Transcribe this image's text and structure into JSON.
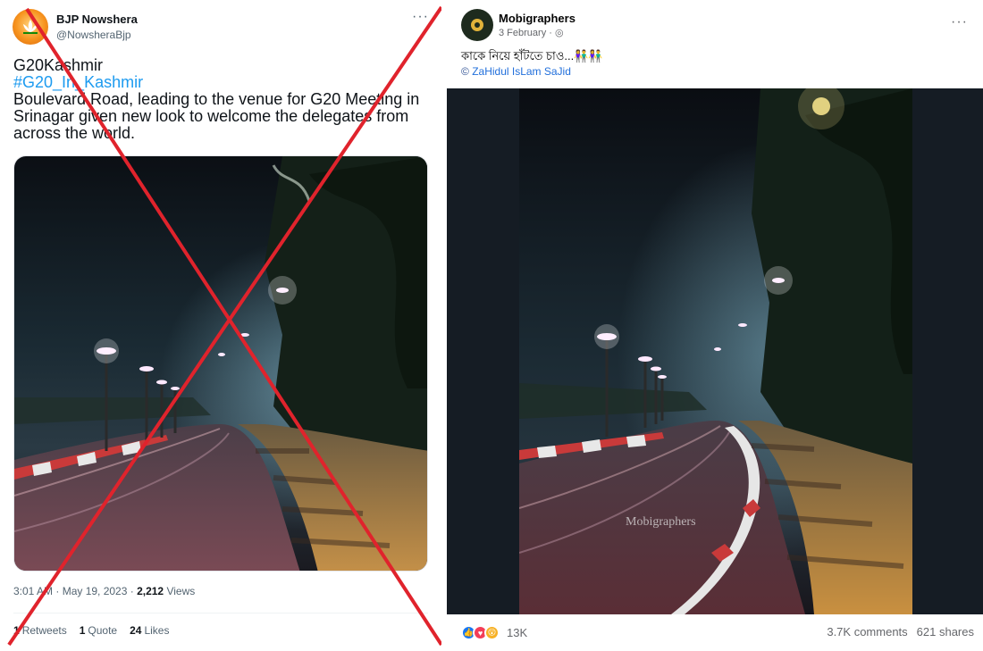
{
  "tweet": {
    "display_name": "BJP Nowshera",
    "handle": "@NowsheraBjp",
    "more_label": "···",
    "text_line1": "G20Kashmir",
    "hashtag": "#G20_In_Kashmir",
    "text_body": "Boulevard Road, leading to the venue for G20 Meeting in Srinagar given new look to welcome the delegates from across the world.",
    "time_date": "3:01 AM · May 19, 2023 · ",
    "views_count": "2,212",
    "views_label": " Views",
    "retweets_count": "1",
    "retweets_label": "Retweets",
    "quotes_count": "1",
    "quotes_label": "Quote",
    "likes_count": "24",
    "likes_label": "Likes",
    "cross_color": "#e0232c",
    "avatar_icon": "lotus-icon"
  },
  "fb_post": {
    "page_name": "Mobigraphers",
    "date": "3 February · ",
    "privacy_icon": "globe-icon",
    "more_label": "···",
    "caption": "কাকে নিয়ে হাঁটতে চাও...👫👫",
    "credit_prefix": "© ",
    "credit_name": "ZaHidul IsLam SaJid",
    "watermark": "Mobigraphers",
    "reactions": [
      "like",
      "love",
      "wow"
    ],
    "reaction_count": "13K",
    "comments": "3.7K comments",
    "shares": "621 shares"
  }
}
